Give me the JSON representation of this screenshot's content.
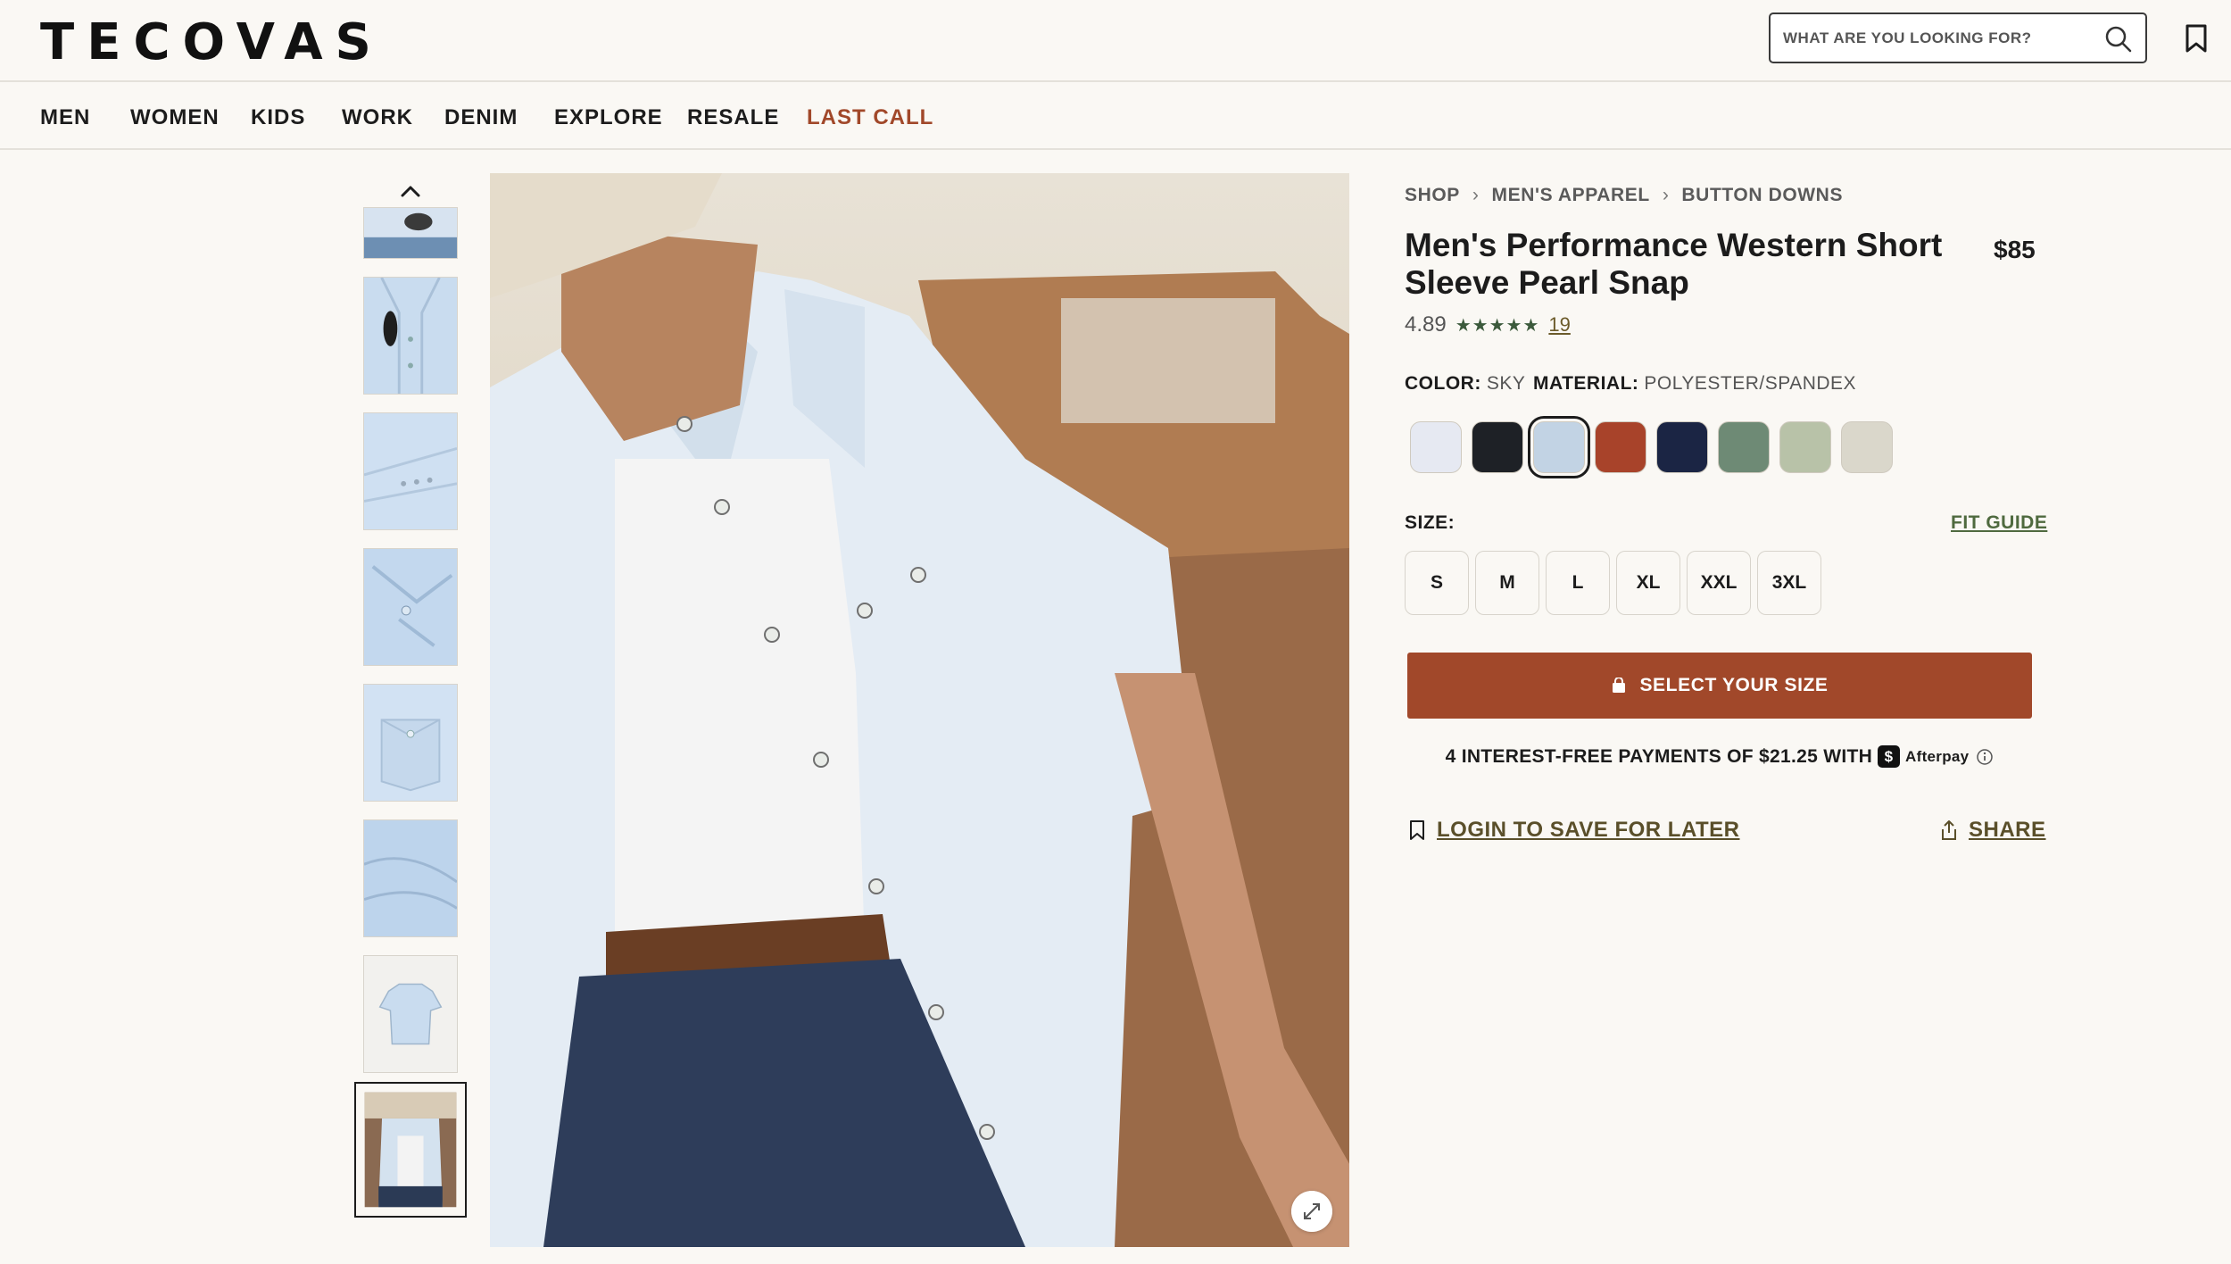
{
  "brand": {
    "logo": "TECOVAS"
  },
  "search": {
    "placeholder": "WHAT ARE YOU LOOKING FOR?"
  },
  "nav": {
    "items": [
      "MEN",
      "WOMEN",
      "KIDS",
      "WORK",
      "DENIM",
      "EXPLORE",
      "RESALE",
      "LAST CALL"
    ],
    "accent_item": "LAST CALL",
    "accent_color": "#a1482a"
  },
  "breadcrumb": [
    "SHOP",
    "MEN'S APPAREL",
    "BUTTON DOWNS"
  ],
  "breadcrumb_sep": "›",
  "product": {
    "title": "Men's Performance Western Short Sleeve Pearl Snap",
    "price": "$85",
    "rating": "4.89",
    "stars": "★★★★★",
    "review_count": "19"
  },
  "attributes": {
    "color_label": "COLOR:",
    "color_value": "SKY",
    "material_label": "MATERIAL:",
    "material_value": "POLYESTER/SPANDEX"
  },
  "swatches": [
    {
      "color": "#e6e9f2",
      "selected": false
    },
    {
      "color": "#1e2126",
      "selected": false
    },
    {
      "color": "#c2d3e4",
      "selected": true
    },
    {
      "color": "#a8432a",
      "selected": false
    },
    {
      "color": "#1b2544",
      "selected": false
    },
    {
      "color": "#6e8a75",
      "selected": false
    },
    {
      "color": "#b8c2a8",
      "selected": false
    },
    {
      "color": "#dad7cb",
      "selected": false
    }
  ],
  "size": {
    "label": "SIZE:",
    "fit_guide": "FIT GUIDE",
    "options": [
      "S",
      "M",
      "L",
      "XL",
      "XXL",
      "3XL"
    ]
  },
  "cta": {
    "label": "SELECT YOUR SIZE",
    "color": "#a1482a"
  },
  "afterpay": {
    "text": "4 INTEREST-FREE PAYMENTS OF $21.25 WITH",
    "badge": "$",
    "brand": "Afterpay"
  },
  "actions": {
    "save_later": "LOGIN TO SAVE FOR LATER",
    "share": "SHARE"
  },
  "icons": [
    "search-icon",
    "bookmark-icon",
    "chevron-up-icon",
    "expand-icon",
    "bag-icon",
    "info-icon",
    "share-icon"
  ]
}
